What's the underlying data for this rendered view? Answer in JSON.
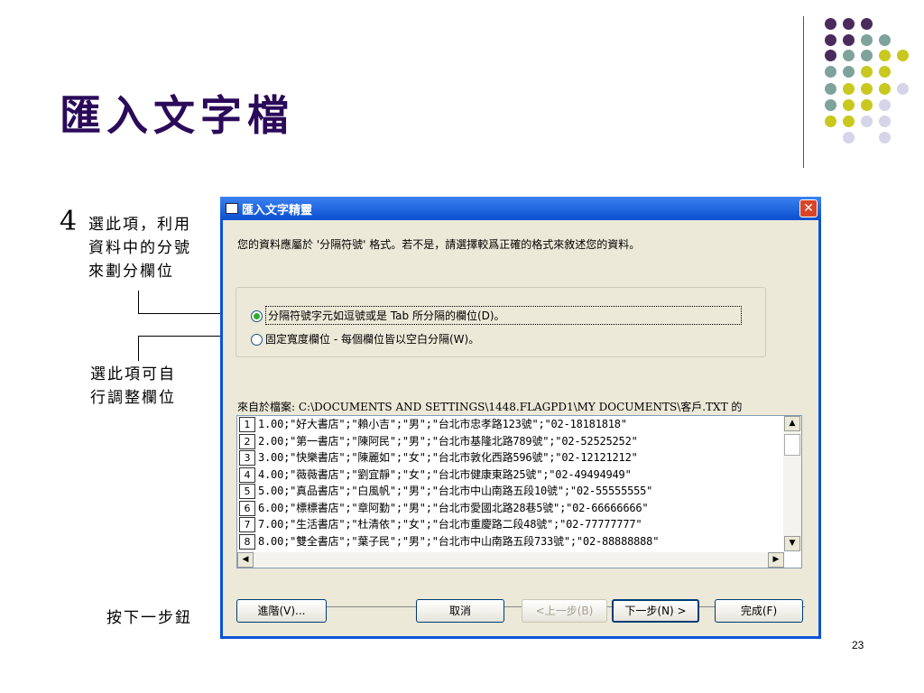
{
  "slide": {
    "title": "匯入文字檔",
    "step_number": "4",
    "note_1": [
      "選此項，利用",
      "資料中的分號",
      "來劃分欄位"
    ],
    "note_2": [
      "選此項可自",
      "行調整欄位"
    ],
    "note_3": "按下一步鈕",
    "page_number": "23",
    "dot_colors": [
      "#4b2a5e",
      "#7ea39a",
      "#c9c81e",
      "#d6d4e8"
    ]
  },
  "dialog": {
    "title": "匯入文字精靈",
    "close_symbol": "✕",
    "intro_text": "您的資料應屬於 '分隔符號' 格式。若不是，請選擇較爲正確的格式來敘述您的資料。",
    "options": [
      {
        "label": "分隔符號字元如逗號或是 Tab 所分隔的欄位(D)。",
        "selected": true
      },
      {
        "label": "固定寬度欄位 - 每個欄位皆以空白分隔(W)。",
        "selected": false
      }
    ],
    "file_label": "來自於檔案: C:\\DOCUMENTS AND SETTINGS\\1448.FLAGPD1\\MY DOCUMENTS\\客戶.TXT 的",
    "preview_rows": [
      {
        "num": "1",
        "text": "1.00;\"好大書店\";\"賴小吉\";\"男\";\"台北市忠孝路123號\";\"02-18181818\""
      },
      {
        "num": "2",
        "text": "2.00;\"第一書店\";\"陳阿民\";\"男\";\"台北市基隆北路789號\";\"02-52525252\""
      },
      {
        "num": "3",
        "text": "3.00;\"快樂書店\";\"陳麗如\";\"女\";\"台北市敦化西路596號\";\"02-12121212\""
      },
      {
        "num": "4",
        "text": "4.00;\"薇薇書店\";\"劉宜靜\";\"女\";\"台北市健康東路25號\";\"02-49494949\""
      },
      {
        "num": "5",
        "text": "5.00;\"真品書店\";\"白風帆\";\"男\";\"台北市中山南路五段10號\";\"02-55555555\""
      },
      {
        "num": "6",
        "text": "6.00;\"標標書店\";\"章阿勤\";\"男\";\"台北市愛國北路28巷5號\";\"02-66666666\""
      },
      {
        "num": "7",
        "text": "7.00;\"生活書店\";\"杜清依\";\"女\";\"台北市重慶路二段48號\";\"02-77777777\""
      },
      {
        "num": "8",
        "text": "8.00;\"雙全書店\";\"葉子民\";\"男\";\"台北市中山南路五段733號\";\"02-88888888\""
      }
    ],
    "buttons": {
      "advanced": "進階(V)...",
      "cancel": "取消",
      "back": "<上一步(B)",
      "next": "下一步(N) >",
      "finish": "完成(F)"
    }
  }
}
